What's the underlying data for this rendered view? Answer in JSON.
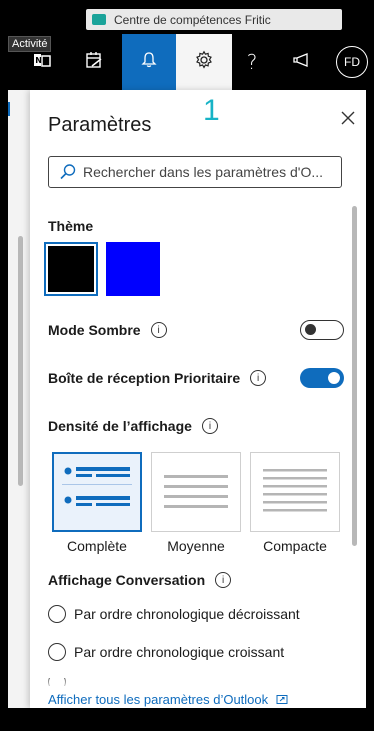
{
  "window": {
    "title": "Centre de compétences Fritic"
  },
  "appbar": {
    "activity_tooltip": "Activité",
    "avatar_initials": "FD",
    "help_label": "?",
    "notifications_active_color": "#0f6cbd",
    "icons": [
      "onenote-icon",
      "todo-icon",
      "bell-icon",
      "gear-icon",
      "help-icon",
      "megaphone-icon"
    ]
  },
  "annotation": {
    "number": "1"
  },
  "settings": {
    "title": "Paramètres",
    "search_placeholder": "Rechercher dans les paramètres d'O...",
    "theme_label": "Thème",
    "themes": [
      {
        "color": "#000000",
        "selected": true
      },
      {
        "color": "#0000ff",
        "selected": false
      }
    ],
    "dark_mode_label": "Mode Sombre",
    "dark_mode_on": false,
    "focused_inbox_label": "Boîte de réception Prioritaire",
    "focused_inbox_on": true,
    "density_label": "Densité de l’affichage",
    "density_options": [
      {
        "label": "Complète",
        "selected": true
      },
      {
        "label": "Moyenne",
        "selected": false
      },
      {
        "label": "Compacte",
        "selected": false
      }
    ],
    "conversation_label": "Affichage Conversation",
    "conversation_options": [
      "Par ordre chronologique décroissant",
      "Par ordre chronologique croissant"
    ],
    "footer_link": "Afficher tous les paramètres d’Outlook",
    "info_glyph": "i",
    "accent_color": "#0f6cbd"
  }
}
